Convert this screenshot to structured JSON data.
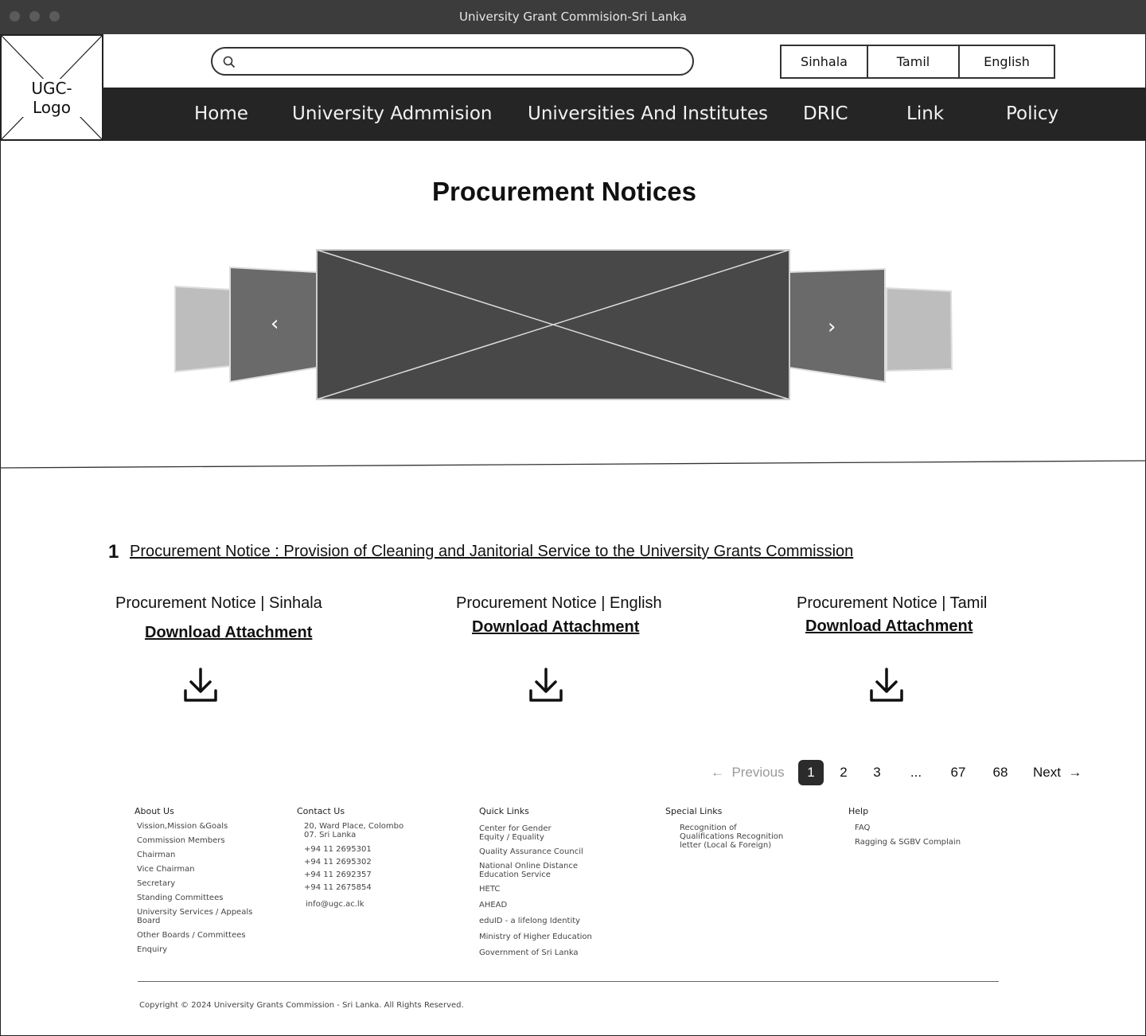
{
  "window": {
    "title": "University Grant Commision-Sri Lanka"
  },
  "header": {
    "logo_text": "UGC-Logo",
    "search_placeholder": "",
    "languages": [
      "Sinhala",
      "Tamil",
      "English"
    ]
  },
  "nav": [
    "Home",
    "University Admmision",
    "Universities And Institutes",
    "DRIC",
    "Link",
    "Policy"
  ],
  "main": {
    "title": "Procurement Notices",
    "carousel": {
      "prev_icon": "chevron-left-icon",
      "next_icon": "chevron-right-icon"
    },
    "notice": {
      "number": "1",
      "title": "Procurement Notice : Provision of Cleaning and Janitorial Service to the University Grants Commission"
    },
    "attachments": [
      {
        "title": "Procurement Notice | Sinhala",
        "link": "Download Attachment",
        "icon": "download-icon"
      },
      {
        "title": "Procurement Notice | English",
        "link": "Download Attachment",
        "icon": "download-icon"
      },
      {
        "title": "Procurement Notice | Tamil",
        "link": "Download Attachment",
        "icon": "download-icon"
      }
    ]
  },
  "pagination": {
    "previous": "Previous",
    "next": "Next",
    "pages": [
      "1",
      "2",
      "3",
      "...",
      "67",
      "68"
    ],
    "current": "1"
  },
  "footer": {
    "about": {
      "heading": "About Us",
      "items": [
        "Vission,Mission &Goals",
        "Commission Members",
        "Chairman",
        "Vice Chairman",
        "Secretary",
        "Standing Committees",
        "University Services / Appeals Board",
        "Other Boards / Committees",
        "Enquiry"
      ]
    },
    "contact": {
      "heading": "Contact Us",
      "address": "20, Ward Place, Colombo 07. Sri Lanka",
      "phones": [
        "+94 11 2695301",
        "+94 11 2695302",
        "+94 11 2692357",
        "+94 11 2675854"
      ],
      "email": "info@ugc.ac.lk"
    },
    "quick": {
      "heading": "Quick Links",
      "items": [
        "Center for Gender Equity / Equality",
        "Quality Assurance Council",
        "National Online Distance Education Service",
        "HETC",
        "AHEAD",
        "eduID - a lifelong Identity",
        "Ministry of Higher Education",
        "Government of Sri Lanka"
      ]
    },
    "special": {
      "heading": "Special Links",
      "items": [
        "Recognition of Qualifications Recognition letter (Local & Foreign)"
      ]
    },
    "help": {
      "heading": "Help",
      "items": [
        "FAQ",
        "Ragging & SGBV Complain"
      ]
    },
    "copyright": "Copyright © 2024 University Grants Commission - Sri Lanka. All Rights Reserved."
  }
}
